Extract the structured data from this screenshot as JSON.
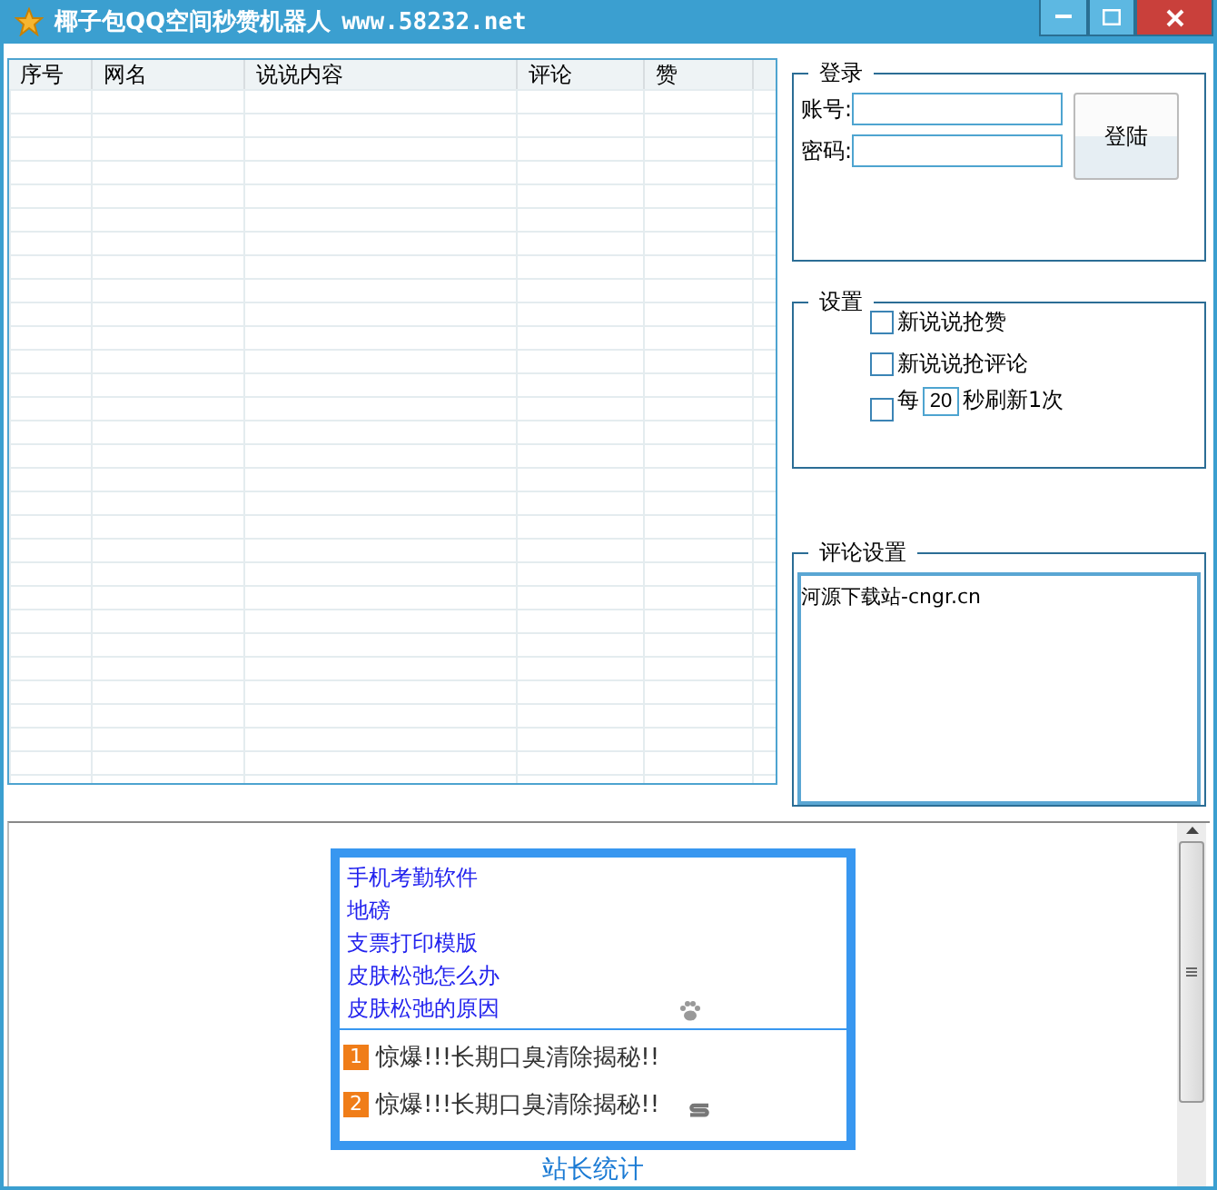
{
  "window": {
    "title": "椰子包QQ空间秒赞机器人",
    "url": "www.58232.net"
  },
  "table": {
    "columns": [
      "序号",
      "网名",
      "说说内容",
      "评论",
      "赞"
    ]
  },
  "login": {
    "title": "登录",
    "fields": [
      {
        "label": "账号:"
      },
      {
        "label": "密码:"
      }
    ],
    "button": "登陆"
  },
  "settings": {
    "title": "设置",
    "options": [
      {
        "kind": "plain",
        "label": "新说说抢赞",
        "checked": false
      },
      {
        "kind": "plain",
        "label": "新说说抢评论",
        "checked": false
      },
      {
        "kind": "interval",
        "before": "每",
        "value": "20",
        "after": "秒刷新1次",
        "checked": false
      }
    ]
  },
  "comment_settings": {
    "title": "评论设置",
    "text": "河源下载站-cngr.cn"
  },
  "ad": {
    "links": [
      "手机考勤软件",
      "地磅",
      "支票打印模版",
      "皮肤松弛怎么办",
      "皮肤松弛的原因"
    ],
    "items": [
      {
        "rank": "1",
        "text": "惊爆!!!长期口臭清除揭秘!!"
      },
      {
        "rank": "2",
        "text": "惊爆!!!长期口臭清除揭秘!!"
      }
    ],
    "footer": "站长统计"
  }
}
